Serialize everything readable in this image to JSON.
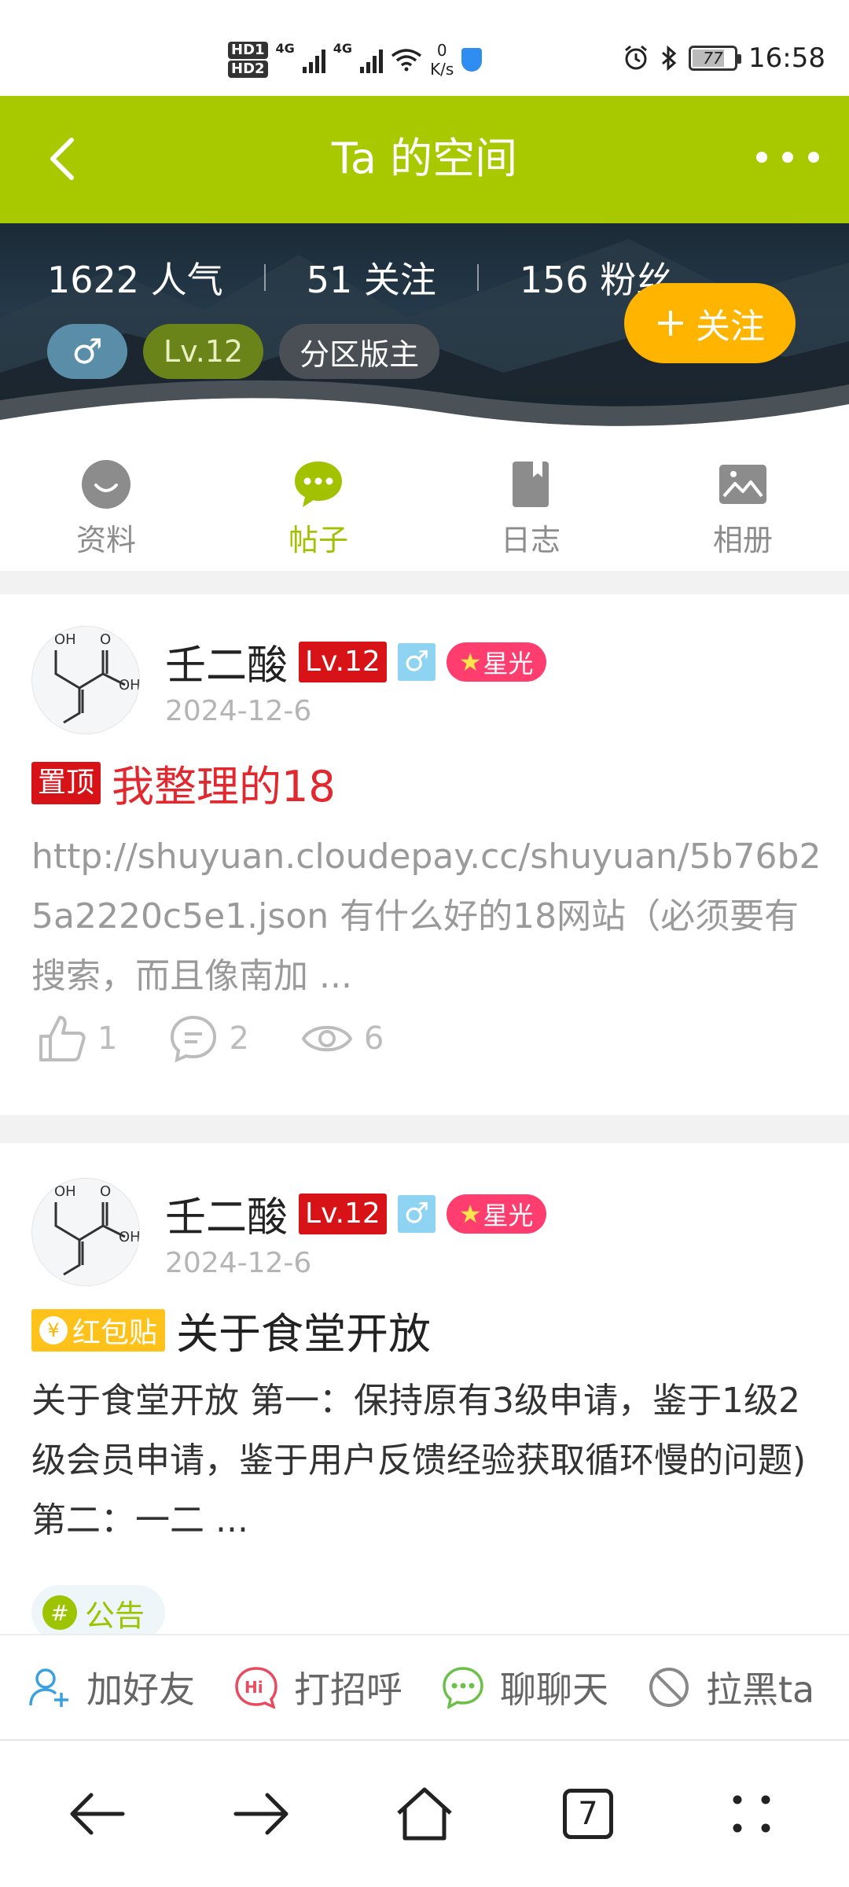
{
  "status_bar": {
    "time": "16:58",
    "battery": "77",
    "net_speed_value": "0",
    "net_speed_unit": "K/s",
    "hd1": "HD1",
    "hd2": "HD2",
    "net1": "4G",
    "net2": "4G"
  },
  "header": {
    "title": "Ta 的空间"
  },
  "profile": {
    "popularity": "1622 人气",
    "following": "51 关注",
    "fans": "156 粉丝",
    "gender_symbol": "♂",
    "level": "Lv.12",
    "role": "分区版主",
    "follow_label": "关注"
  },
  "tabs": [
    {
      "label": "资料"
    },
    {
      "label": "帖子"
    },
    {
      "label": "日志"
    },
    {
      "label": "相册"
    }
  ],
  "posts": [
    {
      "author": "壬二酸",
      "level": "Lv.12",
      "gender": "♂",
      "medal": "星光",
      "date": "2024-12-6",
      "tag": "置顶",
      "title": "我整理的18",
      "excerpt": "http://shuyuan.cloudepay.cc/shuyuan/5b76b25a2220c5e1.json 有什么好的18网站（必须要有搜索，而且像南加 ...",
      "likes": "1",
      "comments": "2",
      "views": "6"
    },
    {
      "author": "壬二酸",
      "level": "Lv.12",
      "gender": "♂",
      "medal": "星光",
      "date": "2024-12-6",
      "tag": "红包贴",
      "title": "关于食堂开放",
      "excerpt": "关于食堂开放 第一：保持原有3级申请，鉴于1级2级会员申请，鉴于用户反馈经验获取循环慢的问题) 第二：一二 ...",
      "topic": "公告"
    }
  ],
  "action_bar": {
    "add_friend": "加好友",
    "greet": "打招呼",
    "greet_badge": "Hi",
    "chat": "聊聊天",
    "block": "拉黑ta"
  },
  "browser_nav": {
    "tab_count": "7"
  },
  "colors": {
    "accent_green": "#a8c800",
    "follow_orange": "#ffb400",
    "level_red": "#d71318",
    "medal_pink": "#ff3d6e"
  }
}
